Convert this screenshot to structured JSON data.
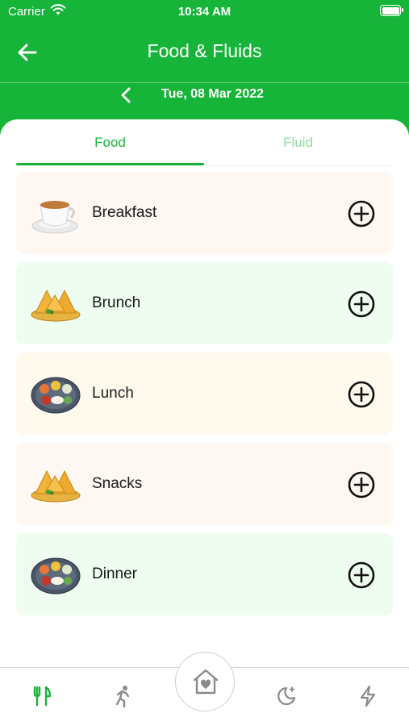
{
  "status_bar": {
    "carrier": "Carrier",
    "time": "10:34 AM"
  },
  "header": {
    "title": "Food & Fluids",
    "date": "Tue, 08 Mar 2022"
  },
  "tabs": [
    {
      "label": "Food",
      "active": true
    },
    {
      "label": "Fluid",
      "active": false
    }
  ],
  "meals": [
    {
      "label": "Breakfast",
      "icon": "tea-cup-icon",
      "bg": "#fff7f2"
    },
    {
      "label": "Brunch",
      "icon": "samosa-icon",
      "bg": "#effdf1"
    },
    {
      "label": "Lunch",
      "icon": "thali-plate-icon",
      "bg": "#fff9ee"
    },
    {
      "label": "Snacks",
      "icon": "samosa-icon",
      "bg": "#fff7f2"
    },
    {
      "label": "Dinner",
      "icon": "thali-plate-icon",
      "bg": "#effdf1"
    }
  ],
  "bottom_nav": [
    "food-icon",
    "activity-icon",
    "home-icon",
    "sleep-icon",
    "energy-icon"
  ],
  "colors": {
    "brand": "#17b43a",
    "fluid_tab": "#8fdca0"
  }
}
